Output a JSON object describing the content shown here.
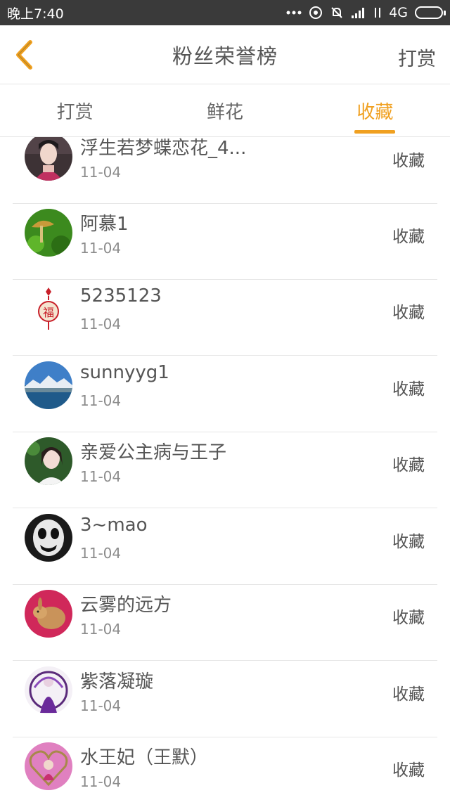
{
  "status_bar": {
    "time": "晚上7:40",
    "network": "4G",
    "icons": [
      "more-dots-icon",
      "alarm-icon",
      "bell-muted-icon",
      "signal-icon",
      "data-arrows-icon",
      "battery-icon"
    ]
  },
  "header": {
    "title": "粉丝荣誉榜",
    "action_label": "打赏",
    "back_icon": "chevron-left-icon"
  },
  "tabs": [
    {
      "label": "打赏",
      "active": false
    },
    {
      "label": "鲜花",
      "active": false
    },
    {
      "label": "收藏",
      "active": true
    }
  ],
  "list": {
    "rows": [
      {
        "name": "浮生若梦蝶恋花_4...",
        "date": "11-04",
        "action": "收藏",
        "avatar": "portrait-woman-red-avatar"
      },
      {
        "name": "阿慕1",
        "date": "11-04",
        "action": "收藏",
        "avatar": "mushroom-avatar"
      },
      {
        "name": "5235123",
        "date": "11-04",
        "action": "收藏",
        "avatar": "chinese-knot-fu-avatar"
      },
      {
        "name": "sunnyyg1",
        "date": "11-04",
        "action": "收藏",
        "avatar": "lake-mountain-avatar"
      },
      {
        "name": "亲爱公主病与王子",
        "date": "11-04",
        "action": "收藏",
        "avatar": "girl-green-avatar"
      },
      {
        "name": "3~mao",
        "date": "11-04",
        "action": "收藏",
        "avatar": "clown-face-avatar"
      },
      {
        "name": "云雾的远方",
        "date": "11-04",
        "action": "收藏",
        "avatar": "rabbit-avatar"
      },
      {
        "name": "紫落凝璇",
        "date": "11-04",
        "action": "收藏",
        "avatar": "purple-anime-avatar"
      },
      {
        "name": "水王妃（王默）",
        "date": "11-04",
        "action": "收藏",
        "avatar": "heart-frame-avatar"
      }
    ]
  },
  "colors": {
    "accent": "#f0a020",
    "status_bar": "#3a3a3a",
    "divider": "#e6e6e6",
    "text": "#555555",
    "subtext": "#8c8c8c"
  }
}
